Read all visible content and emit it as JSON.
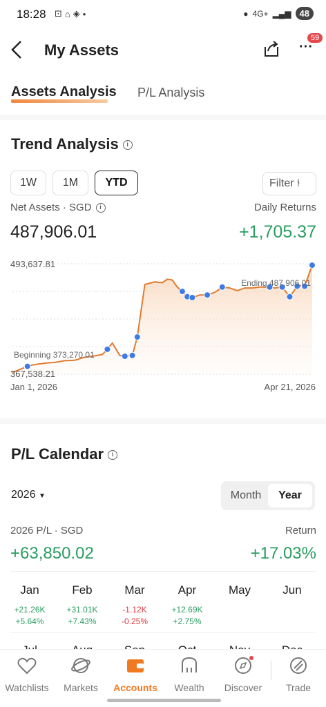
{
  "status": {
    "time": "18:28",
    "network": "4G+",
    "battery": "48"
  },
  "header": {
    "title": "My Assets",
    "badge": "59"
  },
  "tabs": {
    "assets": "Assets Analysis",
    "pl": "P/L Analysis"
  },
  "trend": {
    "title": "Trend Analysis",
    "periods": [
      "1W",
      "1M",
      "YTD"
    ],
    "active_period": "YTD",
    "filter_label": "Filter",
    "net_assets_label": "Net Assets · SGD",
    "net_assets_value": "487,906.01",
    "daily_returns_label": "Daily Returns",
    "daily_returns_value": "+1,705.37"
  },
  "chart_data": {
    "type": "line",
    "y_max_label": "493,637.81",
    "y_min_label": "367,538.21",
    "x_start_label": "Jan 1, 2026",
    "x_end_label": "Apr 21, 2026",
    "beginning_label": "Beginning 373,270.01",
    "ending_label": "Ending 487,906.01",
    "ylim": [
      367538.21,
      493637.81
    ],
    "x": [
      0,
      3,
      6,
      8,
      10,
      14,
      17,
      21,
      25,
      29,
      33,
      36,
      38,
      40,
      43,
      45,
      48,
      50,
      53,
      57,
      60,
      62,
      64,
      66,
      68,
      70,
      72,
      75,
      78,
      81,
      84,
      87,
      90,
      93,
      96,
      99,
      102,
      105,
      108,
      111,
      114,
      117,
      120
    ],
    "values": [
      369500,
      373000,
      376500,
      378000,
      379000,
      380500,
      381000,
      383000,
      383500,
      387000,
      388500,
      390000,
      396000,
      403000,
      389000,
      388000,
      389000,
      410000,
      470000,
      473000,
      472000,
      476000,
      475000,
      467000,
      462000,
      456000,
      455000,
      458000,
      458000,
      461000,
      467000,
      466000,
      463000,
      466000,
      466000,
      467000,
      467000,
      466000,
      467000,
      456000,
      468000,
      468000,
      492000
    ],
    "dividend_markers": [
      6,
      38,
      45,
      48,
      50,
      68,
      70,
      72,
      78,
      84,
      103,
      108,
      111,
      114,
      117,
      120
    ],
    "grid": true,
    "line_color": "#e07a2e"
  },
  "calendar": {
    "title": "P/L Calendar",
    "year": "2026",
    "seg_month": "Month",
    "seg_year": "Year",
    "pl_label": "2026 P/L · SGD",
    "pl_value": "+63,850.02",
    "return_label": "Return",
    "return_value": "+17.03%",
    "months": [
      {
        "name": "Jan",
        "v1": "+21.26K",
        "v2": "+5.64%",
        "dir": "up"
      },
      {
        "name": "Feb",
        "v1": "+31.01K",
        "v2": "+7.43%",
        "dir": "up"
      },
      {
        "name": "Mar",
        "v1": "-1.12K",
        "v2": "-0.25%",
        "dir": "down"
      },
      {
        "name": "Apr",
        "v1": "+12.69K",
        "v2": "+2.75%",
        "dir": "up"
      },
      {
        "name": "May",
        "v1": "",
        "v2": "",
        "dir": ""
      },
      {
        "name": "Jun",
        "v1": "",
        "v2": "",
        "dir": ""
      }
    ],
    "months_row2": [
      "Jul",
      "Aug",
      "Sep",
      "Oct",
      "Nov",
      "Dec"
    ]
  },
  "nav": {
    "items": [
      "Watchlists",
      "Markets",
      "Accounts",
      "Wealth",
      "Discover",
      "Trade"
    ],
    "active": "Accounts"
  },
  "colors": {
    "accent": "#f07a22",
    "positive": "#2a9d61",
    "negative": "#d9363e"
  }
}
